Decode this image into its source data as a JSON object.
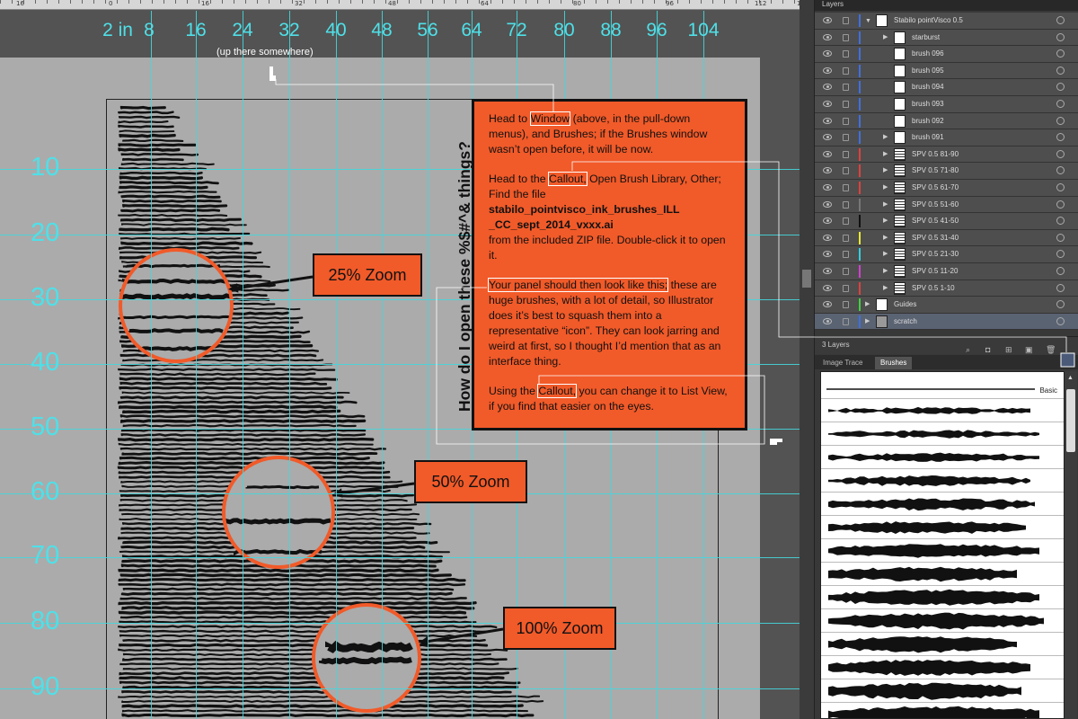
{
  "ruler": {
    "numbers": [
      "16",
      "0",
      "16",
      "32",
      "48",
      "64",
      "80",
      "96",
      "112",
      "12"
    ]
  },
  "canvas": {
    "top_labels": [
      "2 in",
      "8",
      "16",
      "24",
      "32",
      "40",
      "48",
      "56",
      "64",
      "72",
      "80",
      "88",
      "96",
      "104"
    ],
    "side_labels": [
      "10",
      "20",
      "30",
      "40",
      "50",
      "60",
      "70",
      "80",
      "90"
    ],
    "pointer_note": "(up there somewhere)",
    "zoom_labels": [
      "25% Zoom",
      "50% Zoom",
      "100% Zoom"
    ],
    "vertical_heading": "How do I open these %$#^& things?",
    "accent_color": "#f15a29",
    "guide_color": "#45d6dc"
  },
  "info": {
    "p1_a": "Head to ",
    "p1_hl": "Window",
    "p1_b": " (above, in the pull-down menus), and Brushes; if the Brushes window wasn’t open before, it will be now.",
    "p2_a": "Head to the ",
    "p2_hl": "Callout,",
    "p2_b": " Open Brush Library, Other; Find the file",
    "p2_file": "stabilo_pointvisco_ink_brushes_ILL _CC_sept_2014_vxxx.ai",
    "p2_c": "from the included ZIP file. Double-click it to open it.",
    "p3_hl": "Your panel should then look like this;",
    "p3_b": " these are huge brushes, with a lot of detail, so Illustrator does it’s best to squash them into a representative “icon”. They can look jarring and weird at first, so I thought I’d mention that as an interface thing.",
    "p4_a": "Using the ",
    "p4_hl": "Callout,",
    "p4_b": " you can change it to List View, if you find that easier on the eyes."
  },
  "layers_panel": {
    "tab_label": "Layers",
    "rows": [
      {
        "name": "Stabilo pointVisco 0.5",
        "color": "#3f6fe0",
        "level": 0,
        "expanded": true,
        "thumb": "white"
      },
      {
        "name": "starburst",
        "color": "#3f6fe0",
        "level": 1,
        "expanded": false,
        "thumb": "white"
      },
      {
        "name": "brush 096",
        "color": "#3f6fe0",
        "level": 1,
        "expanded": null,
        "thumb": "white"
      },
      {
        "name": "brush 095",
        "color": "#3f6fe0",
        "level": 1,
        "expanded": null,
        "thumb": "white"
      },
      {
        "name": "brush 094",
        "color": "#3f6fe0",
        "level": 1,
        "expanded": null,
        "thumb": "white"
      },
      {
        "name": "brush 093",
        "color": "#3f6fe0",
        "level": 1,
        "expanded": null,
        "thumb": "white"
      },
      {
        "name": "brush 092",
        "color": "#3f6fe0",
        "level": 1,
        "expanded": null,
        "thumb": "white"
      },
      {
        "name": "brush 091",
        "color": "#3f6fe0",
        "level": 1,
        "expanded": false,
        "thumb": "white"
      },
      {
        "name": "SPV 0.5 81-90",
        "color": "#e04040",
        "level": 1,
        "expanded": false,
        "thumb": "striped"
      },
      {
        "name": "SPV 0.5 71-80",
        "color": "#e04040",
        "level": 1,
        "expanded": false,
        "thumb": "striped"
      },
      {
        "name": "SPV 0.5 61-70",
        "color": "#e04040",
        "level": 1,
        "expanded": false,
        "thumb": "striped"
      },
      {
        "name": "SPV 0.5 51-60",
        "color": "#777777",
        "level": 1,
        "expanded": false,
        "thumb": "striped"
      },
      {
        "name": "SPV 0.5 41-50",
        "color": "#111111",
        "level": 1,
        "expanded": false,
        "thumb": "striped"
      },
      {
        "name": "SPV 0.5 31-40",
        "color": "#e8e830",
        "level": 1,
        "expanded": false,
        "thumb": "striped"
      },
      {
        "name": "SPV 0.5 21-30",
        "color": "#30d0e0",
        "level": 1,
        "expanded": false,
        "thumb": "striped"
      },
      {
        "name": "SPV 0.5 11-20",
        "color": "#d040d0",
        "level": 1,
        "expanded": false,
        "thumb": "striped"
      },
      {
        "name": "SPV 0.5 1-10",
        "color": "#e04040",
        "level": 1,
        "expanded": false,
        "thumb": "striped"
      },
      {
        "name": "Guides",
        "color": "#40d040",
        "level": 0,
        "expanded": false,
        "thumb": "white"
      },
      {
        "name": "scratch",
        "color": "#3f6fe0",
        "level": 0,
        "expanded": false,
        "thumb": "gray",
        "selected": true
      }
    ],
    "footer_count": "3 Layers"
  },
  "brushes_panel": {
    "tabs": [
      "Image Trace",
      "Brushes"
    ],
    "active_tab": "Brushes",
    "first_brush_label": "Basic"
  }
}
